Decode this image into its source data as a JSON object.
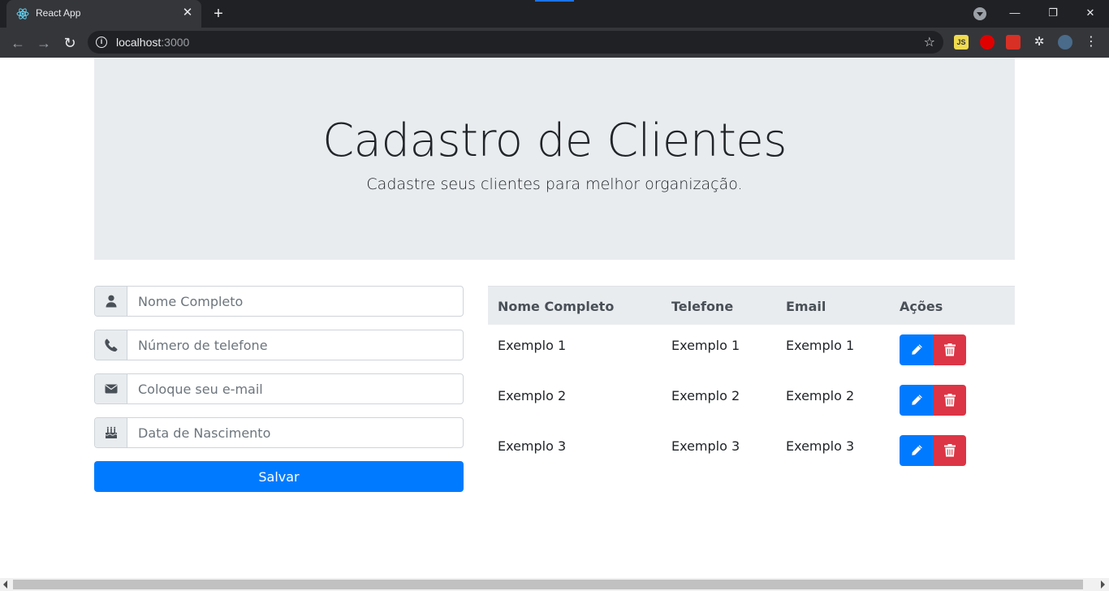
{
  "browser": {
    "tab_title": "React App",
    "tab_close": "✕",
    "new_tab": "+",
    "url_host": "localhost",
    "url_port": ":3000",
    "extensions": [
      {
        "name": "js-extension-icon",
        "label": "JS",
        "bg": "#f0db4f",
        "fg": "#323330"
      },
      {
        "name": "adblock-extension-icon",
        "label": "",
        "bg": "#e00000",
        "fg": "#ffffff"
      },
      {
        "name": "red-extension-icon",
        "label": "",
        "bg": "#d93025",
        "fg": "#ffffff"
      },
      {
        "name": "puzzle-extensions-icon",
        "label": "",
        "bg": "transparent",
        "fg": "#e8eaed"
      },
      {
        "name": "profile-avatar-icon",
        "label": "",
        "bg": "#4a6b8a",
        "fg": "#ffffff"
      }
    ],
    "window_controls": {
      "minimize": "—",
      "restore": "❐",
      "close": "✕"
    }
  },
  "header": {
    "title": "Cadastro de Clientes",
    "subtitle": "Cadastre seus clientes para melhor organização."
  },
  "form": {
    "fields": [
      {
        "name": "full-name-input",
        "icon": "user-icon",
        "placeholder": "Nome Completo",
        "value": ""
      },
      {
        "name": "phone-input",
        "icon": "phone-icon",
        "placeholder": "Número de telefone",
        "value": ""
      },
      {
        "name": "email-input",
        "icon": "envelope-icon",
        "placeholder": "Coloque seu e-mail",
        "value": ""
      },
      {
        "name": "birthdate-input",
        "icon": "birthday-cake-icon",
        "placeholder": "Data de Nascimento",
        "value": ""
      }
    ],
    "save_label": "Salvar"
  },
  "table": {
    "headers": [
      "Nome Completo",
      "Telefone",
      "Email",
      "Ações"
    ],
    "rows": [
      [
        "Exemplo 1",
        "Exemplo 1",
        "Exemplo 1"
      ],
      [
        "Exemplo 2",
        "Exemplo 2",
        "Exemplo 2"
      ],
      [
        "Exemplo 3",
        "Exemplo 3",
        "Exemplo 3"
      ]
    ]
  },
  "colors": {
    "primary": "#007bff",
    "danger": "#dc3545",
    "jumbotron": "#e9ecef"
  }
}
